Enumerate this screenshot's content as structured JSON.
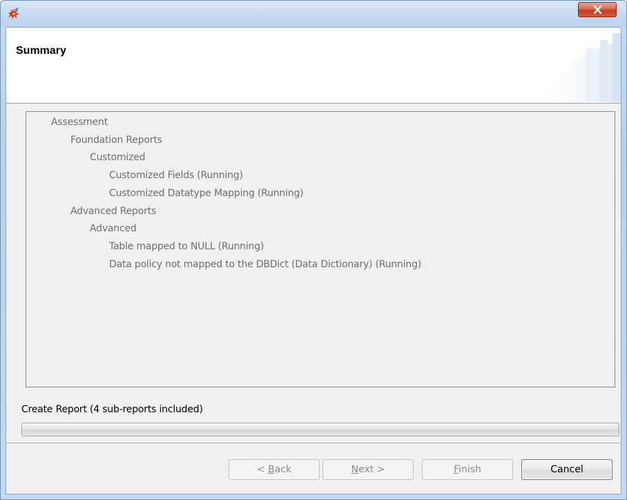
{
  "window": {
    "title": "",
    "icon": "app-flower-icon",
    "close_icon": "close-x-icon",
    "colors": {
      "titlebar": "#c5d9ef",
      "close_button": "#c9452a"
    }
  },
  "header": {
    "title": "Summary"
  },
  "tree": {
    "items": [
      {
        "label": "Assessment",
        "level": 0
      },
      {
        "label": "Foundation Reports",
        "level": 1
      },
      {
        "label": "Customized",
        "level": 2
      },
      {
        "label": "Customized Fields (Running)",
        "level": 3
      },
      {
        "label": "Customized Datatype Mapping (Running)",
        "level": 3
      },
      {
        "label": "Advanced Reports",
        "level": 1
      },
      {
        "label": "Advanced",
        "level": 2
      },
      {
        "label": "Table mapped to NULL (Running)",
        "level": 3
      },
      {
        "label": "Data policy not mapped to the DBDict (Data Dictionary) (Running)",
        "level": 3
      }
    ]
  },
  "status": {
    "label": "Create Report (4 sub-reports included)",
    "progress_fraction": 0.0
  },
  "buttons": {
    "back": {
      "prefix": "< ",
      "mnemonic": "B",
      "rest": "ack",
      "enabled": false
    },
    "next": {
      "prefix": "",
      "mnemonic": "N",
      "rest": "ext >",
      "enabled": false
    },
    "finish": {
      "prefix": "",
      "mnemonic": "F",
      "rest": "inish",
      "enabled": false
    },
    "cancel": {
      "label": "Cancel",
      "enabled": true
    }
  }
}
